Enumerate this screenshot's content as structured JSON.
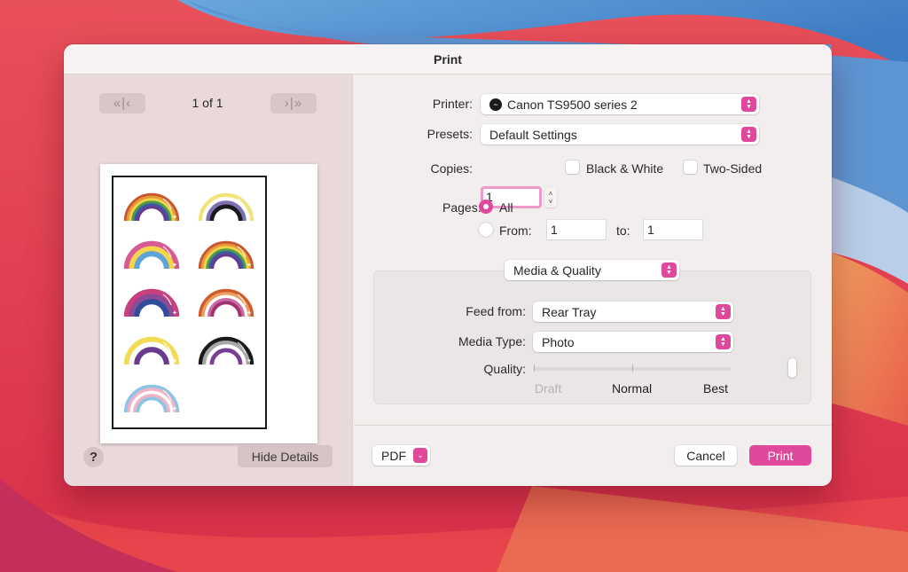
{
  "window": {
    "title": "Print"
  },
  "preview": {
    "page_indicator": "1 of 1",
    "first_prev_label": "«|‹",
    "next_last_label": "›|»",
    "rainbows": [
      {
        "name": "progress-pride",
        "bands": [
          "#c8562e",
          "#e79a3a",
          "#f1d44a",
          "#4f9b4a",
          "#3c58a5",
          "#6a3a8e"
        ]
      },
      {
        "name": "nonbinary",
        "bands": [
          "#f2e27a",
          "#ffffff",
          "#7d6fb3",
          "#1a1a1a"
        ]
      },
      {
        "name": "pansexual",
        "bands": [
          "#d85a95",
          "#f3d54a",
          "#5fa4d8"
        ]
      },
      {
        "name": "pride-black-triangle",
        "bands": [
          "#c8562e",
          "#e79a3a",
          "#f1d44a",
          "#4f9b4a",
          "#3c58a5",
          "#6a3a8e"
        ]
      },
      {
        "name": "bisexual",
        "bands": [
          "#c8407e",
          "#8a4a95",
          "#2f4d99"
        ]
      },
      {
        "name": "lesbian",
        "bands": [
          "#d05c2a",
          "#eaa061",
          "#ffffff",
          "#c86aa4",
          "#a3316e"
        ]
      },
      {
        "name": "intersex-nb",
        "bands": [
          "#f3db55",
          "#ffffff",
          "#6a3a8e"
        ]
      },
      {
        "name": "asexual",
        "bands": [
          "#1a1a1a",
          "#a8a8a8",
          "#ffffff",
          "#7a3e93"
        ]
      },
      {
        "name": "transgender",
        "bands": [
          "#8dc4e6",
          "#f1b4c4",
          "#ffffff",
          "#f1b4c4",
          "#8dc4e6"
        ]
      }
    ]
  },
  "left_footer": {
    "help_label": "?",
    "hide_details_label": "Hide Details"
  },
  "form": {
    "printer_label": "Printer:",
    "printer_value": "Canon TS9500 series 2",
    "presets_label": "Presets:",
    "presets_value": "Default Settings",
    "copies_label": "Copies:",
    "copies_value": "1",
    "black_white_label": "Black & White",
    "black_white_checked": false,
    "two_sided_label": "Two-Sided",
    "two_sided_checked": false,
    "pages_label": "Pages:",
    "pages_all_label": "All",
    "pages_selected": "All",
    "pages_from_label": "From:",
    "pages_from_value": "1",
    "pages_to_label": "to:",
    "pages_to_value": "1",
    "section_value": "Media & Quality"
  },
  "media_quality": {
    "feed_from_label": "Feed from:",
    "feed_from_value": "Rear Tray",
    "media_type_label": "Media Type:",
    "media_type_value": "Photo",
    "quality_label": "Quality:",
    "quality_levels": [
      "Draft",
      "Normal",
      "Best"
    ],
    "quality_selected": "Best"
  },
  "footer": {
    "pdf_label": "PDF",
    "cancel_label": "Cancel",
    "print_label": "Print"
  },
  "colors": {
    "accent": "#e0489c"
  }
}
